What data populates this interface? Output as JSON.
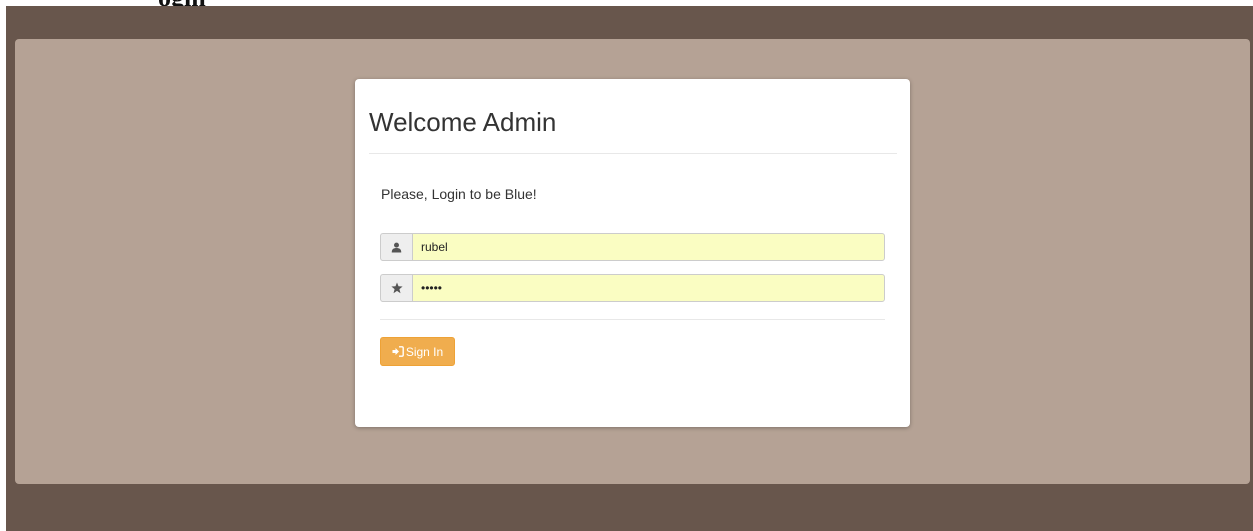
{
  "page": {
    "cut_title": "ogin"
  },
  "login": {
    "heading": "Welcome Admin",
    "intro": "Please, Login to be Blue!",
    "username": {
      "icon": "user-icon",
      "value": "rubel"
    },
    "password": {
      "icon": "star-icon",
      "value": "rubel"
    },
    "submit": {
      "icon": "sign-in-icon",
      "label": "Sign In"
    }
  },
  "colors": {
    "frame": "#68564c",
    "panel": "#b5a295",
    "card": "#ffffff",
    "input_autofill": "#fafdc2",
    "button_warning": "#f0ad4e"
  }
}
